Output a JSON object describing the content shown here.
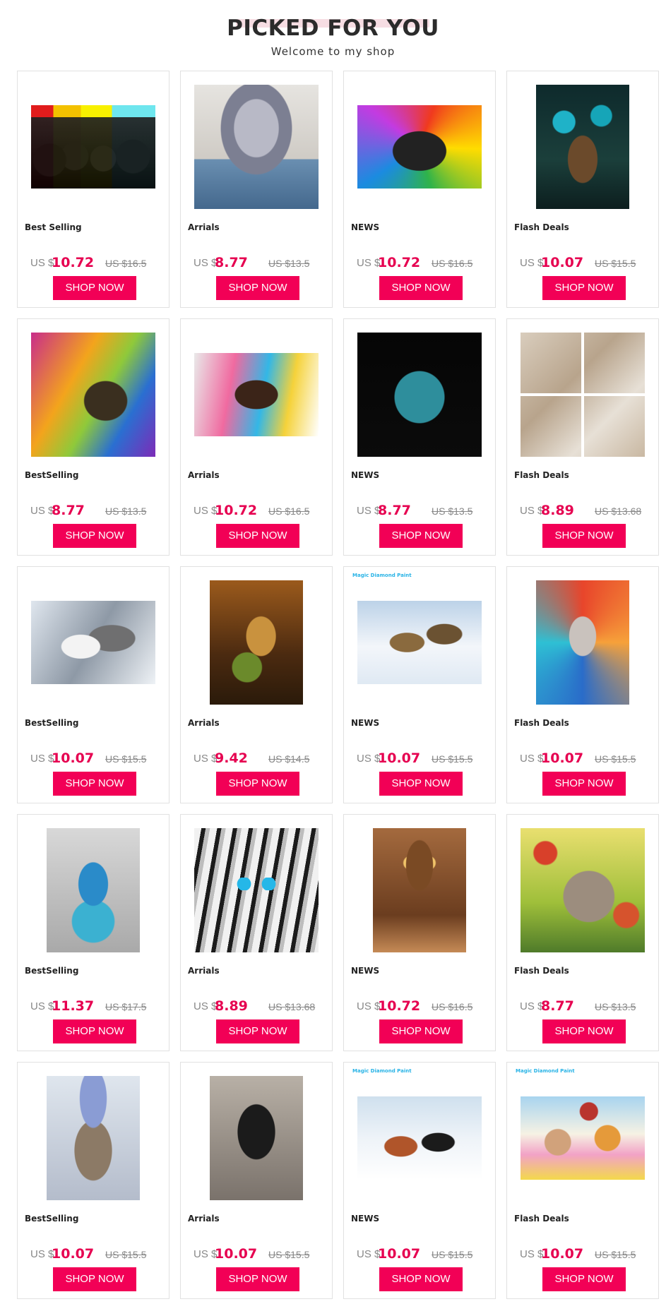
{
  "header": {
    "title": "PICKED FOR YOU",
    "subtitle": "Welcome to my shop"
  },
  "colors": {
    "accent": "#f20056",
    "price": "#e60050",
    "title_highlight": "#f6dde3"
  },
  "products": [
    {
      "category": "Best Selling",
      "currency": "US $",
      "price": "10.72",
      "old_price": "US $16.5",
      "button": "SHOP NOW",
      "art": "p1",
      "shape": "land",
      "brand": ""
    },
    {
      "category": "Arrials",
      "currency": "US $",
      "price": "8.77",
      "old_price": "US $13.5",
      "button": "SHOP NOW",
      "art": "p2",
      "shape": "sq",
      "brand": ""
    },
    {
      "category": "NEWS",
      "currency": "US $",
      "price": "10.72",
      "old_price": "US $16.5",
      "button": "SHOP NOW",
      "art": "p3",
      "shape": "land",
      "brand": ""
    },
    {
      "category": "Flash Deals",
      "currency": "US $",
      "price": "10.07",
      "old_price": "US $15.5",
      "button": "SHOP NOW",
      "art": "p4",
      "shape": "port",
      "brand": ""
    },
    {
      "category": "BestSelling",
      "currency": "US $",
      "price": "8.77",
      "old_price": "US $13.5",
      "button": "SHOP NOW",
      "art": "p5",
      "shape": "sq",
      "brand": ""
    },
    {
      "category": "Arrials",
      "currency": "US $",
      "price": "10.72",
      "old_price": "US $16.5",
      "button": "SHOP NOW",
      "art": "p6",
      "shape": "land",
      "brand": ""
    },
    {
      "category": "NEWS",
      "currency": "US $",
      "price": "8.77",
      "old_price": "US $13.5",
      "button": "SHOP NOW",
      "art": "p7",
      "shape": "sq",
      "brand": ""
    },
    {
      "category": "Flash Deals",
      "currency": "US $",
      "price": "8.89",
      "old_price": "US $13.68",
      "button": "SHOP NOW",
      "art": "p8",
      "shape": "sq",
      "brand": ""
    },
    {
      "category": "BestSelling",
      "currency": "US $",
      "price": "10.07",
      "old_price": "US $15.5",
      "button": "SHOP NOW",
      "art": "p9",
      "shape": "land",
      "brand": ""
    },
    {
      "category": "Arrials",
      "currency": "US $",
      "price": "9.42",
      "old_price": "US $14.5",
      "button": "SHOP NOW",
      "art": "p10",
      "shape": "port",
      "brand": ""
    },
    {
      "category": "NEWS",
      "currency": "US $",
      "price": "10.07",
      "old_price": "US $15.5",
      "button": "SHOP NOW",
      "art": "p11",
      "shape": "land",
      "brand": "Magic Diamond Paint"
    },
    {
      "category": "Flash Deals",
      "currency": "US $",
      "price": "10.07",
      "old_price": "US $15.5",
      "button": "SHOP NOW",
      "art": "p12",
      "shape": "port",
      "brand": ""
    },
    {
      "category": "BestSelling",
      "currency": "US $",
      "price": "11.37",
      "old_price": "US $17.5",
      "button": "SHOP NOW",
      "art": "p13",
      "shape": "port",
      "brand": ""
    },
    {
      "category": "Arrials",
      "currency": "US $",
      "price": "8.89",
      "old_price": "US $13.68",
      "button": "SHOP NOW",
      "art": "p14",
      "shape": "sq",
      "brand": ""
    },
    {
      "category": "NEWS",
      "currency": "US $",
      "price": "10.72",
      "old_price": "US $16.5",
      "button": "SHOP NOW",
      "art": "p15",
      "shape": "port",
      "brand": ""
    },
    {
      "category": "Flash Deals",
      "currency": "US $",
      "price": "8.77",
      "old_price": "US $13.5",
      "button": "SHOP NOW",
      "art": "p16",
      "shape": "sq",
      "brand": ""
    },
    {
      "category": "BestSelling",
      "currency": "US $",
      "price": "10.07",
      "old_price": "US $15.5",
      "button": "SHOP NOW",
      "art": "p17",
      "shape": "port",
      "brand": ""
    },
    {
      "category": "Arrials",
      "currency": "US $",
      "price": "10.07",
      "old_price": "US $15.5",
      "button": "SHOP NOW",
      "art": "p18",
      "shape": "port",
      "brand": ""
    },
    {
      "category": "NEWS",
      "currency": "US $",
      "price": "10.07",
      "old_price": "US $15.5",
      "button": "SHOP NOW",
      "art": "p19",
      "shape": "land",
      "brand": "Magic Diamond Paint"
    },
    {
      "category": "Flash Deals",
      "currency": "US $",
      "price": "10.07",
      "old_price": "US $15.5",
      "button": "SHOP NOW",
      "art": "p20",
      "shape": "land",
      "brand": "Magic Diamond Paint"
    }
  ]
}
